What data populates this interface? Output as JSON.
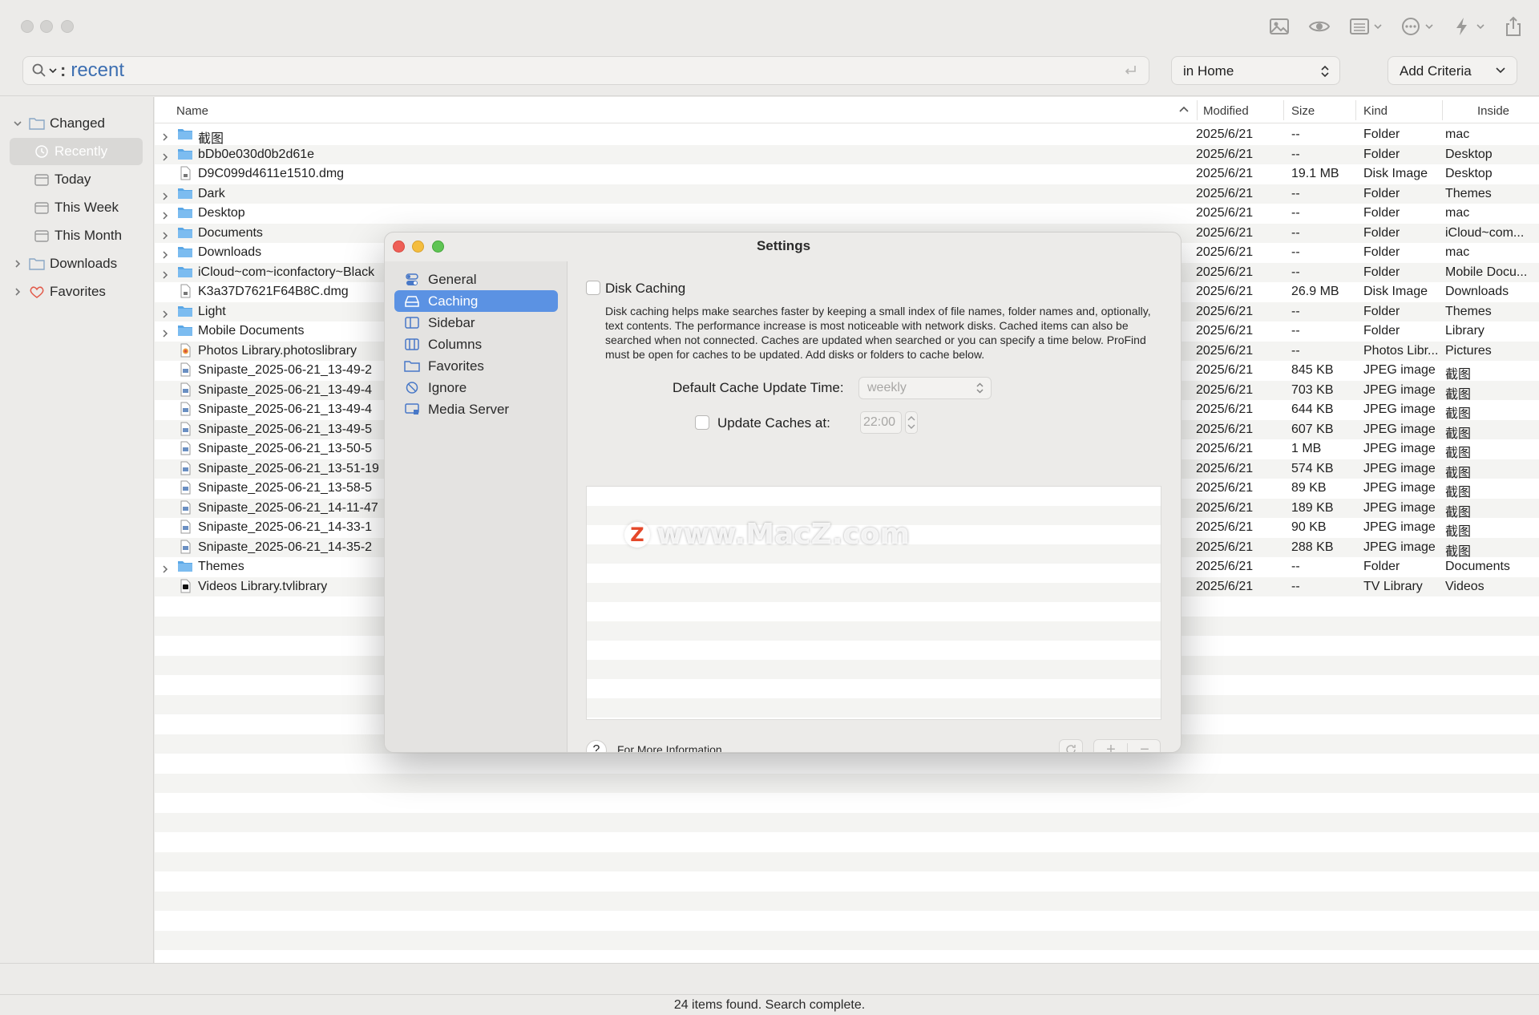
{
  "search": {
    "query": "recent",
    "separator": ":"
  },
  "scope": {
    "value": "in Home"
  },
  "criteria": {
    "label": "Add Criteria"
  },
  "toolbar": {
    "icons": [
      "image-icon",
      "eye-icon",
      "list-icon",
      "ellipsis-icon",
      "flash-icon",
      "share-icon"
    ]
  },
  "sidebar": {
    "items": [
      {
        "label": "Changed",
        "icon": "folder-icon"
      },
      {
        "label": "Recently",
        "icon": "clock-icon"
      },
      {
        "label": "Today",
        "icon": "calendar-icon"
      },
      {
        "label": "This Week",
        "icon": "calendar-icon"
      },
      {
        "label": "This Month",
        "icon": "calendar-icon"
      },
      {
        "label": "Downloads",
        "icon": "folder-icon"
      },
      {
        "label": "Favorites",
        "icon": "heart-icon"
      }
    ]
  },
  "table": {
    "headers": {
      "name": "Name",
      "modified": "Modified",
      "size": "Size",
      "kind": "Kind",
      "inside": "Inside"
    },
    "rows": [
      {
        "name": "截图",
        "type": "folder",
        "modified": "2025/6/21",
        "size": "--",
        "kind": "Folder",
        "inside": "mac"
      },
      {
        "name": "bDb0e030d0b2d61e",
        "type": "folder",
        "modified": "2025/6/21",
        "size": "--",
        "kind": "Folder",
        "inside": "Desktop"
      },
      {
        "name": "D9C099d4611e1510.dmg",
        "type": "file",
        "modified": "2025/6/21",
        "size": "19.1 MB",
        "kind": "Disk Image",
        "inside": "Desktop"
      },
      {
        "name": "Dark",
        "type": "folder",
        "modified": "2025/6/21",
        "size": "--",
        "kind": "Folder",
        "inside": "Themes"
      },
      {
        "name": "Desktop",
        "type": "folder",
        "modified": "2025/6/21",
        "size": "--",
        "kind": "Folder",
        "inside": "mac"
      },
      {
        "name": "Documents",
        "type": "folder",
        "modified": "2025/6/21",
        "size": "--",
        "kind": "Folder",
        "inside": "iCloud~com..."
      },
      {
        "name": "Downloads",
        "type": "folder",
        "modified": "2025/6/21",
        "size": "--",
        "kind": "Folder",
        "inside": "mac"
      },
      {
        "name": "iCloud~com~iconfactory~Black",
        "type": "folder",
        "modified": "2025/6/21",
        "size": "--",
        "kind": "Folder",
        "inside": "Mobile Docu..."
      },
      {
        "name": "K3a37D7621F64B8C.dmg",
        "type": "file",
        "modified": "2025/6/21",
        "size": "26.9 MB",
        "kind": "Disk Image",
        "inside": "Downloads"
      },
      {
        "name": "Light",
        "type": "folder",
        "modified": "2025/6/21",
        "size": "--",
        "kind": "Folder",
        "inside": "Themes"
      },
      {
        "name": "Mobile Documents",
        "type": "folder",
        "modified": "2025/6/21",
        "size": "--",
        "kind": "Folder",
        "inside": "Library"
      },
      {
        "name": "Photos Library.photoslibrary",
        "type": "photos",
        "modified": "2025/6/21",
        "size": "--",
        "kind": "Photos Libr...",
        "inside": "Pictures"
      },
      {
        "name": "Snipaste_2025-06-21_13-49-2",
        "type": "image",
        "modified": "2025/6/21",
        "size": "845 KB",
        "kind": "JPEG image",
        "inside": "截图"
      },
      {
        "name": "Snipaste_2025-06-21_13-49-4",
        "type": "image",
        "modified": "2025/6/21",
        "size": "703 KB",
        "kind": "JPEG image",
        "inside": "截图"
      },
      {
        "name": "Snipaste_2025-06-21_13-49-4",
        "type": "image",
        "modified": "2025/6/21",
        "size": "644 KB",
        "kind": "JPEG image",
        "inside": "截图"
      },
      {
        "name": "Snipaste_2025-06-21_13-49-5",
        "type": "image",
        "modified": "2025/6/21",
        "size": "607 KB",
        "kind": "JPEG image",
        "inside": "截图"
      },
      {
        "name": "Snipaste_2025-06-21_13-50-5",
        "type": "image",
        "modified": "2025/6/21",
        "size": "1 MB",
        "kind": "JPEG image",
        "inside": "截图"
      },
      {
        "name": "Snipaste_2025-06-21_13-51-19",
        "type": "image",
        "modified": "2025/6/21",
        "size": "574 KB",
        "kind": "JPEG image",
        "inside": "截图"
      },
      {
        "name": "Snipaste_2025-06-21_13-58-5",
        "type": "image",
        "modified": "2025/6/21",
        "size": "89 KB",
        "kind": "JPEG image",
        "inside": "截图"
      },
      {
        "name": "Snipaste_2025-06-21_14-11-47",
        "type": "image",
        "modified": "2025/6/21",
        "size": "189 KB",
        "kind": "JPEG image",
        "inside": "截图"
      },
      {
        "name": "Snipaste_2025-06-21_14-33-1",
        "type": "image",
        "modified": "2025/6/21",
        "size": "90 KB",
        "kind": "JPEG image",
        "inside": "截图"
      },
      {
        "name": "Snipaste_2025-06-21_14-35-2",
        "type": "image",
        "modified": "2025/6/21",
        "size": "288 KB",
        "kind": "JPEG image",
        "inside": "截图"
      },
      {
        "name": "Themes",
        "type": "folder",
        "modified": "2025/6/21",
        "size": "--",
        "kind": "Folder",
        "inside": "Documents"
      },
      {
        "name": "Videos Library.tvlibrary",
        "type": "tv",
        "modified": "2025/6/21",
        "size": "--",
        "kind": "TV Library",
        "inside": "Videos"
      }
    ]
  },
  "status": {
    "text": "24 items found. Search complete."
  },
  "settings": {
    "title": "Settings",
    "nav": [
      {
        "label": "General",
        "icon": "toggles-icon"
      },
      {
        "label": "Caching",
        "icon": "drive-icon"
      },
      {
        "label": "Sidebar",
        "icon": "sidebar-icon"
      },
      {
        "label": "Columns",
        "icon": "columns-icon"
      },
      {
        "label": "Favorites",
        "icon": "folder-icon"
      },
      {
        "label": "Ignore",
        "icon": "prohibit-icon"
      },
      {
        "label": "Media Server",
        "icon": "display-icon"
      }
    ],
    "disk_caching_label": "Disk Caching",
    "description": "Disk caching helps make searches faster by keeping a small index of file names, folder names and, optionally, text contents. The performance increase is most noticeable with network disks. Cached items can also be searched when not connected. Caches are updated when searched or you can specify a time below. ProFind must be open for caches to be updated. Add disks or folders to cache below.",
    "default_update_label": "Default Cache Update Time:",
    "default_update_value": "weekly",
    "update_at_label": "Update Caches at:",
    "update_at_value": "22:00",
    "help_symbol": "?",
    "more_info": "For More Information",
    "add_symbol": "+",
    "remove_symbol": "−"
  },
  "watermark": {
    "logo": "Z",
    "text": "www.MacZ.com"
  },
  "colors": {
    "accent": "#5b92e3",
    "folder": "#5aa7e6",
    "query": "#3d6fb1"
  }
}
